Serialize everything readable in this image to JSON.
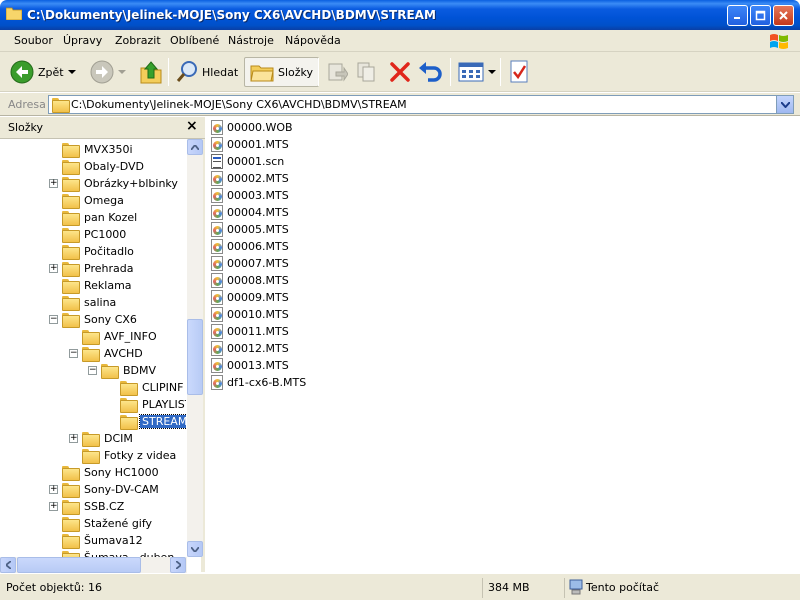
{
  "window": {
    "title": "C:\\Dokumenty\\Jelinek-MOJE\\Sony CX6\\AVCHD\\BDMV\\STREAM"
  },
  "menu": [
    "Soubor",
    "Úpravy",
    "Zobrazit",
    "Oblíbené",
    "Nástroje",
    "Nápověda"
  ],
  "toolbar": {
    "back_label": "Zpět",
    "search_label": "Hledat",
    "folders_label": "Složky"
  },
  "address": {
    "label": "Adresa",
    "value": "C:\\Dokumenty\\Jelinek-MOJE\\Sony CX6\\AVCHD\\BDMV\\STREAM"
  },
  "folders_pane": {
    "title": "Složky",
    "items": [
      {
        "label": "MVX350i",
        "level": 0,
        "expander": ""
      },
      {
        "label": "Obaly-DVD",
        "level": 0,
        "expander": ""
      },
      {
        "label": "Obrázky+blbinky",
        "level": 0,
        "expander": "+"
      },
      {
        "label": "Omega",
        "level": 0,
        "expander": ""
      },
      {
        "label": "pan Kozel",
        "level": 0,
        "expander": ""
      },
      {
        "label": "PC1000",
        "level": 0,
        "expander": ""
      },
      {
        "label": "Počitadlo",
        "level": 0,
        "expander": ""
      },
      {
        "label": "Prehrada",
        "level": 0,
        "expander": "+"
      },
      {
        "label": "Reklama",
        "level": 0,
        "expander": ""
      },
      {
        "label": "salina",
        "level": 0,
        "expander": ""
      },
      {
        "label": "Sony CX6",
        "level": 0,
        "expander": "-"
      },
      {
        "label": "AVF_INFO",
        "level": 1,
        "expander": ""
      },
      {
        "label": "AVCHD",
        "level": 1,
        "expander": "-"
      },
      {
        "label": "BDMV",
        "level": 2,
        "expander": "-"
      },
      {
        "label": "CLIPINF",
        "level": 3,
        "expander": ""
      },
      {
        "label": "PLAYLIST",
        "level": 3,
        "expander": ""
      },
      {
        "label": "STREAM",
        "level": 3,
        "expander": "",
        "selected": true
      },
      {
        "label": "DCIM",
        "level": 1,
        "expander": "+"
      },
      {
        "label": "Fotky z videa",
        "level": 1,
        "expander": ""
      },
      {
        "label": "Sony HC1000",
        "level": 0,
        "expander": ""
      },
      {
        "label": "Sony-DV-CAM",
        "level": 0,
        "expander": "+"
      },
      {
        "label": "SSB.CZ",
        "level": 0,
        "expander": "+"
      },
      {
        "label": "Stažené gify",
        "level": 0,
        "expander": ""
      },
      {
        "label": "Šumava12",
        "level": 0,
        "expander": ""
      },
      {
        "label": "Šumava - duben",
        "level": 0,
        "expander": ""
      }
    ]
  },
  "files": [
    {
      "name": "00000.WOB",
      "icon": "media-file-icon"
    },
    {
      "name": "00001.MTS",
      "icon": "media-file-icon"
    },
    {
      "name": "00001.scn",
      "icon": "scn-file-icon"
    },
    {
      "name": "00002.MTS",
      "icon": "media-file-icon"
    },
    {
      "name": "00003.MTS",
      "icon": "media-file-icon"
    },
    {
      "name": "00004.MTS",
      "icon": "media-file-icon"
    },
    {
      "name": "00005.MTS",
      "icon": "media-file-icon"
    },
    {
      "name": "00006.MTS",
      "icon": "media-file-icon"
    },
    {
      "name": "00007.MTS",
      "icon": "media-file-icon"
    },
    {
      "name": "00008.MTS",
      "icon": "media-file-icon"
    },
    {
      "name": "00009.MTS",
      "icon": "media-file-icon"
    },
    {
      "name": "00010.MTS",
      "icon": "media-file-icon"
    },
    {
      "name": "00011.MTS",
      "icon": "media-file-icon"
    },
    {
      "name": "00012.MTS",
      "icon": "media-file-icon"
    },
    {
      "name": "00013.MTS",
      "icon": "media-file-icon"
    },
    {
      "name": "df1-cx6-B.MTS",
      "icon": "media-file-icon"
    }
  ],
  "status": {
    "count": "Počet objektů: 16",
    "size": "384 MB",
    "location": "Tento počítač"
  },
  "colors": {
    "titlebar": "#0054e3",
    "selection": "#316ac5",
    "chrome": "#ece9d8"
  }
}
